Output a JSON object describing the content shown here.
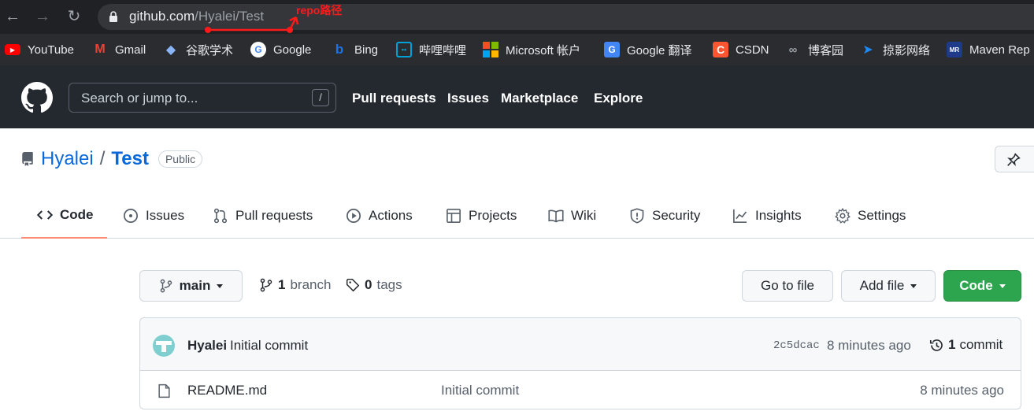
{
  "browser": {
    "url_host": "github.com",
    "url_path": "/Hyalei/Test",
    "annotation": "repo路径",
    "bookmarks": [
      {
        "label": "YouTube",
        "icon": "youtube-icon"
      },
      {
        "label": "Gmail",
        "icon": "gmail-icon"
      },
      {
        "label": "谷歌学术",
        "icon": "scholar-icon"
      },
      {
        "label": "Google",
        "icon": "google-icon"
      },
      {
        "label": "Bing",
        "icon": "bing-icon"
      },
      {
        "label": "哔哩哔哩",
        "icon": "bilibili-icon"
      },
      {
        "label": "Microsoft 帐户",
        "icon": "microsoft-icon"
      },
      {
        "label": "Google 翻译",
        "icon": "translate-icon"
      },
      {
        "label": "CSDN",
        "icon": "csdn-icon"
      },
      {
        "label": "博客园",
        "icon": "cnblogs-icon"
      },
      {
        "label": "掠影网络",
        "icon": "send-icon"
      },
      {
        "label": "Maven Rep",
        "icon": "maven-icon"
      }
    ]
  },
  "header": {
    "search_placeholder": "Search or jump to...",
    "search_shortcut": "/",
    "nav": [
      "Pull requests",
      "Issues",
      "Marketplace",
      "Explore"
    ]
  },
  "repo": {
    "owner": "Hyalei",
    "separator": "/",
    "name": "Test",
    "visibility": "Public"
  },
  "tabs": [
    {
      "label": "Code",
      "icon": "code-icon",
      "active": true
    },
    {
      "label": "Issues",
      "icon": "issue-icon"
    },
    {
      "label": "Pull requests",
      "icon": "pull-request-icon"
    },
    {
      "label": "Actions",
      "icon": "play-icon"
    },
    {
      "label": "Projects",
      "icon": "table-icon"
    },
    {
      "label": "Wiki",
      "icon": "book-icon"
    },
    {
      "label": "Security",
      "icon": "shield-icon"
    },
    {
      "label": "Insights",
      "icon": "graph-icon"
    },
    {
      "label": "Settings",
      "icon": "gear-icon"
    }
  ],
  "toolbar": {
    "branch": "main",
    "branch_count": "1",
    "branch_label": "branch",
    "tag_count": "0",
    "tag_label": "tags",
    "goto_file": "Go to file",
    "add_file": "Add file",
    "code": "Code"
  },
  "commit": {
    "author": "Hyalei",
    "message": "Initial commit",
    "sha": "2c5dcac",
    "time": "8 minutes ago",
    "count": "1",
    "count_label": "commit"
  },
  "files": [
    {
      "name": "README.md",
      "message": "Initial commit",
      "time": "8 minutes ago"
    }
  ],
  "colors": {
    "accent_link": "#0969da",
    "active_tab_underline": "#fd8c73",
    "code_button": "#2da44e",
    "annotation_red": "#ff1a1a"
  }
}
